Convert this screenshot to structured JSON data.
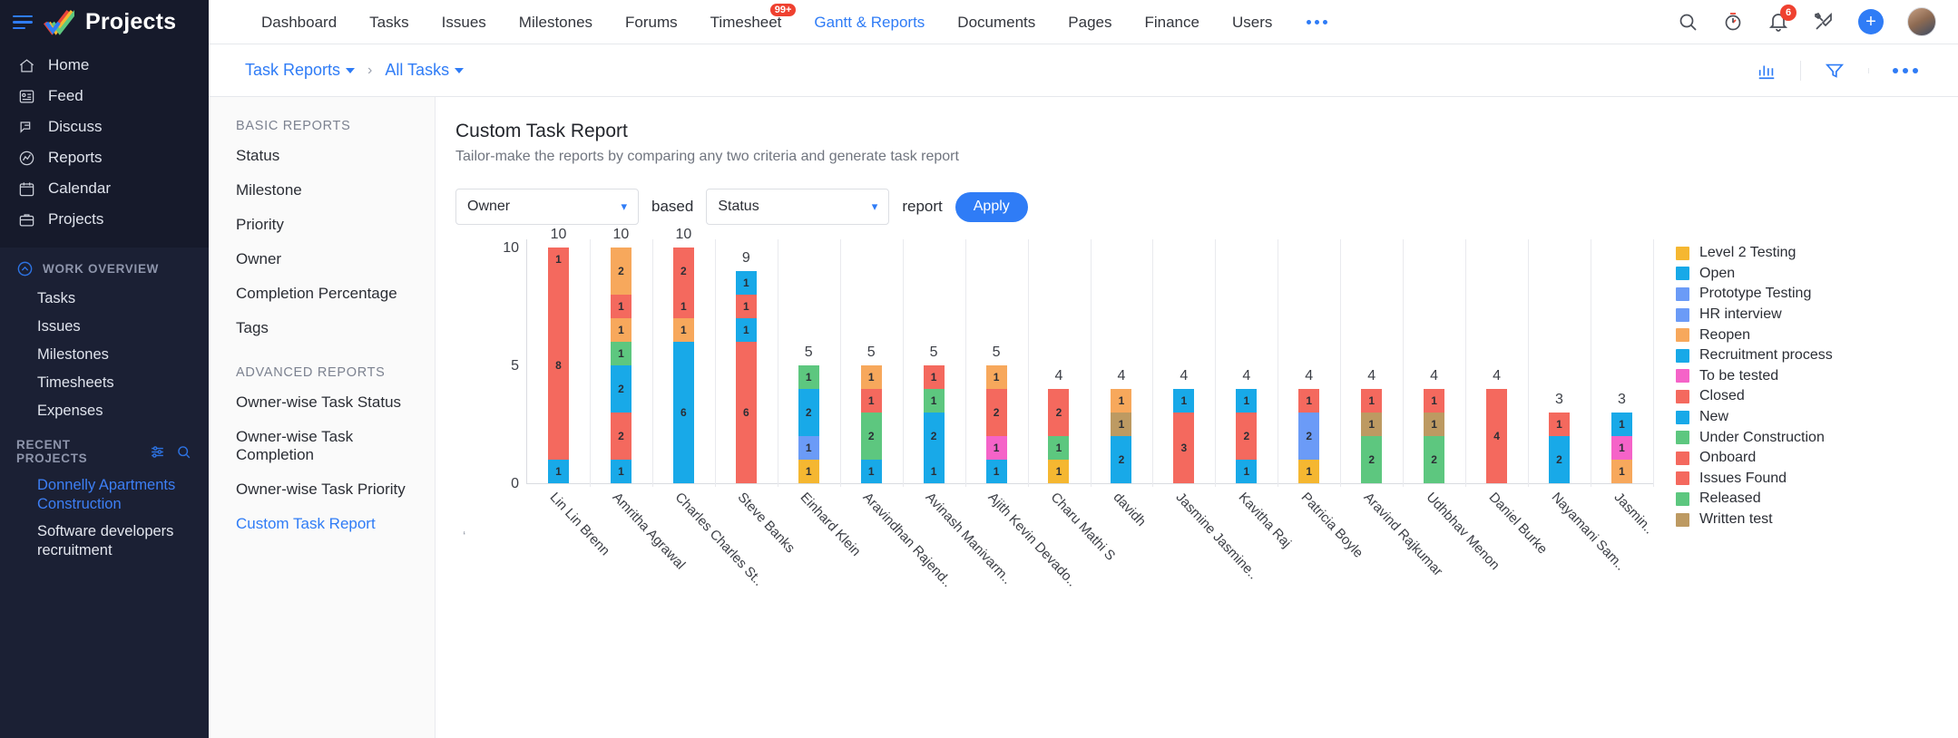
{
  "brand": {
    "title": "Projects"
  },
  "sidebar": {
    "primary": [
      {
        "label": "Home",
        "icon": "home-icon"
      },
      {
        "label": "Feed",
        "icon": "feed-icon"
      },
      {
        "label": "Discuss",
        "icon": "discuss-icon"
      },
      {
        "label": "Reports",
        "icon": "reports-icon"
      },
      {
        "label": "Calendar",
        "icon": "calendar-icon"
      },
      {
        "label": "Projects",
        "icon": "briefcase-icon"
      }
    ],
    "work_overview": {
      "title": "WORK OVERVIEW",
      "items": [
        "Tasks",
        "Issues",
        "Milestones",
        "Timesheets",
        "Expenses"
      ]
    },
    "recent_projects": {
      "title": "RECENT PROJECTS",
      "items": [
        {
          "label": "Donnelly Apartments Construction",
          "active": true
        },
        {
          "label": "Software developers recruitment",
          "active": false
        }
      ]
    }
  },
  "topnav": {
    "items": [
      {
        "label": "Dashboard",
        "active": false,
        "badge": ""
      },
      {
        "label": "Tasks",
        "active": false,
        "badge": ""
      },
      {
        "label": "Issues",
        "active": false,
        "badge": ""
      },
      {
        "label": "Milestones",
        "active": false,
        "badge": ""
      },
      {
        "label": "Forums",
        "active": false,
        "badge": ""
      },
      {
        "label": "Timesheet",
        "active": false,
        "badge": "99+"
      },
      {
        "label": "Gantt & Reports",
        "active": true,
        "badge": ""
      },
      {
        "label": "Documents",
        "active": false,
        "badge": ""
      },
      {
        "label": "Pages",
        "active": false,
        "badge": ""
      },
      {
        "label": "Finance",
        "active": false,
        "badge": ""
      },
      {
        "label": "Users",
        "active": false,
        "badge": ""
      }
    ],
    "more_label": "more-menu",
    "icons": [
      "search-icon",
      "timer-icon",
      "bell-icon",
      "tools-icon",
      "add-icon",
      "avatar"
    ],
    "notification_count": "6",
    "add_label": "+"
  },
  "breadcrumb": {
    "first": "Task Reports",
    "separator": "›",
    "second": "All Tasks"
  },
  "subbar_actions": [
    "chart-view-icon",
    "filter-icon",
    "more-icon"
  ],
  "reports_panel": {
    "basic_title": "BASIC REPORTS",
    "basic_items": [
      "Status",
      "Milestone",
      "Priority",
      "Owner",
      "Completion Percentage",
      "Tags"
    ],
    "advanced_title": "ADVANCED REPORTS",
    "advanced_items": [
      {
        "label": "Owner-wise Task Status",
        "active": false
      },
      {
        "label": "Owner-wise Task Completion",
        "active": false
      },
      {
        "label": "Owner-wise Task Priority",
        "active": false
      },
      {
        "label": "Custom Task Report",
        "active": true
      }
    ]
  },
  "content": {
    "title": "Custom Task Report",
    "subtitle": "Tailor-make the reports by comparing any two criteria and generate task report",
    "filter": {
      "left_select": "Owner",
      "middle_label": "based",
      "right_select": "Status",
      "trailing_label": "report",
      "apply_label": "Apply"
    }
  },
  "chart_data": {
    "type": "bar",
    "stacked": true,
    "title": "",
    "xlabel": "",
    "ylabel": "",
    "ylim": [
      0,
      10
    ],
    "yticks": [
      0,
      5,
      10
    ],
    "grid": true,
    "legend_position": "right",
    "legend": [
      {
        "label": "Level 2 Testing",
        "color": "#f5b731"
      },
      {
        "label": "Open",
        "color": "#18a9e8"
      },
      {
        "label": "Prototype Testing",
        "color": "#6b9bf7"
      },
      {
        "label": "HR interview",
        "color": "#6b9bf7"
      },
      {
        "label": "Reopen",
        "color": "#f7a85c"
      },
      {
        "label": "Recruitment process",
        "color": "#18a9e8"
      },
      {
        "label": "To be tested",
        "color": "#f563c8"
      },
      {
        "label": "Closed",
        "color": "#f4695e"
      },
      {
        "label": "New",
        "color": "#18a9e8"
      },
      {
        "label": "Under Construction",
        "color": "#5dc77f"
      },
      {
        "label": "Onboard",
        "color": "#f4695e"
      },
      {
        "label": "Issues Found",
        "color": "#f4695e"
      },
      {
        "label": "Released",
        "color": "#5dc77f"
      },
      {
        "label": "Written test",
        "color": "#bd9a62"
      }
    ],
    "categories": [
      "Lin Lin Brenn",
      "Amritha Agrawal",
      "Charles Charles St..",
      "Steve Banks",
      "Einhard Klein",
      "Aravindhan Rajend..",
      "Avinash Manivarm..",
      "Ajith Kevin Devado..",
      "Charu Mathi S",
      "davidh",
      "Jasmine Jasmine..",
      "Kavitha Raj",
      "Patricia Boyle",
      "Aravind Rajkumar",
      "Udhbhav Menon",
      "Daniel Burke",
      "Nayamani Sam..",
      "Jasmin.."
    ],
    "totals": [
      10,
      10,
      10,
      9,
      5,
      5,
      5,
      5,
      4,
      4,
      4,
      4,
      4,
      4,
      4,
      4,
      3,
      3
    ],
    "bars": [
      {
        "category": "Lin Lin Brenn",
        "total": 10,
        "segments": [
          {
            "value": 1,
            "color": "#f4695e"
          },
          {
            "value": 8,
            "color": "#f4695e"
          },
          {
            "value": 1,
            "color": "#18a9e8"
          }
        ]
      },
      {
        "category": "Amritha Agrawal",
        "total": 10,
        "segments": [
          {
            "value": 2,
            "color": "#f7a85c"
          },
          {
            "value": 1,
            "color": "#f4695e"
          },
          {
            "value": 1,
            "color": "#f7a85c"
          },
          {
            "value": 1,
            "color": "#5dc77f"
          },
          {
            "value": 2,
            "color": "#18a9e8"
          },
          {
            "value": 2,
            "color": "#f4695e"
          },
          {
            "value": 1,
            "color": "#18a9e8"
          }
        ]
      },
      {
        "category": "Charles Charles St..",
        "total": 10,
        "segments": [
          {
            "value": 2,
            "color": "#f4695e"
          },
          {
            "value": 1,
            "color": "#f4695e"
          },
          {
            "value": 1,
            "color": "#f7a85c"
          },
          {
            "value": 6,
            "color": "#18a9e8"
          }
        ]
      },
      {
        "category": "Steve Banks",
        "total": 9,
        "segments": [
          {
            "value": 1,
            "color": "#18a9e8"
          },
          {
            "value": 1,
            "color": "#f4695e"
          },
          {
            "value": 1,
            "color": "#18a9e8"
          },
          {
            "value": 6,
            "color": "#f4695e"
          }
        ]
      },
      {
        "category": "Einhard Klein",
        "total": 5,
        "segments": [
          {
            "value": 1,
            "color": "#5dc77f"
          },
          {
            "value": 2,
            "color": "#18a9e8"
          },
          {
            "value": 1,
            "color": "#6b9bf7"
          },
          {
            "value": 1,
            "color": "#f5b731"
          }
        ]
      },
      {
        "category": "Aravindhan Rajend..",
        "total": 5,
        "segments": [
          {
            "value": 1,
            "color": "#f7a85c"
          },
          {
            "value": 1,
            "color": "#f4695e"
          },
          {
            "value": 2,
            "color": "#5dc77f"
          },
          {
            "value": 1,
            "color": "#18a9e8"
          }
        ]
      },
      {
        "category": "Avinash Manivarm..",
        "total": 5,
        "segments": [
          {
            "value": 1,
            "color": "#f4695e"
          },
          {
            "value": 1,
            "color": "#5dc77f"
          },
          {
            "value": 2,
            "color": "#18a9e8"
          },
          {
            "value": 1,
            "color": "#18a9e8"
          }
        ]
      },
      {
        "category": "Ajith Kevin Devado..",
        "total": 5,
        "segments": [
          {
            "value": 1,
            "color": "#f7a85c"
          },
          {
            "value": 2,
            "color": "#f4695e"
          },
          {
            "value": 1,
            "color": "#f563c8"
          },
          {
            "value": 1,
            "color": "#18a9e8"
          }
        ]
      },
      {
        "category": "Charu Mathi S",
        "total": 4,
        "segments": [
          {
            "value": 2,
            "color": "#f4695e"
          },
          {
            "value": 1,
            "color": "#5dc77f"
          },
          {
            "value": 1,
            "color": "#f5b731"
          }
        ]
      },
      {
        "category": "davidh",
        "total": 4,
        "segments": [
          {
            "value": 1,
            "color": "#f7a85c"
          },
          {
            "value": 1,
            "color": "#bd9a62"
          },
          {
            "value": 2,
            "color": "#18a9e8"
          }
        ]
      },
      {
        "category": "Jasmine Jasmine..",
        "total": 4,
        "segments": [
          {
            "value": 1,
            "color": "#18a9e8"
          },
          {
            "value": 3,
            "color": "#f4695e"
          }
        ]
      },
      {
        "category": "Kavitha Raj",
        "total": 4,
        "segments": [
          {
            "value": 1,
            "color": "#18a9e8"
          },
          {
            "value": 2,
            "color": "#f4695e"
          },
          {
            "value": 1,
            "color": "#18a9e8"
          }
        ]
      },
      {
        "category": "Patricia Boyle",
        "total": 4,
        "segments": [
          {
            "value": 1,
            "color": "#f4695e"
          },
          {
            "value": 2,
            "color": "#6b9bf7"
          },
          {
            "value": 1,
            "color": "#f5b731"
          }
        ]
      },
      {
        "category": "Aravind Rajkumar",
        "total": 4,
        "segments": [
          {
            "value": 1,
            "color": "#f4695e"
          },
          {
            "value": 1,
            "color": "#bd9a62"
          },
          {
            "value": 2,
            "color": "#5dc77f"
          }
        ]
      },
      {
        "category": "Udhbhav Menon",
        "total": 4,
        "segments": [
          {
            "value": 1,
            "color": "#f4695e"
          },
          {
            "value": 1,
            "color": "#bd9a62"
          },
          {
            "value": 2,
            "color": "#5dc77f"
          }
        ]
      },
      {
        "category": "Daniel Burke",
        "total": 4,
        "segments": [
          {
            "value": 4,
            "color": "#f4695e"
          }
        ]
      },
      {
        "category": "Nayamani Sam..",
        "total": 3,
        "segments": [
          {
            "value": 1,
            "color": "#f4695e"
          },
          {
            "value": 2,
            "color": "#18a9e8"
          }
        ]
      },
      {
        "category": "Jasmin..",
        "total": 3,
        "segments": [
          {
            "value": 1,
            "color": "#18a9e8"
          },
          {
            "value": 1,
            "color": "#f563c8"
          },
          {
            "value": 1,
            "color": "#f7a85c"
          }
        ]
      }
    ]
  }
}
